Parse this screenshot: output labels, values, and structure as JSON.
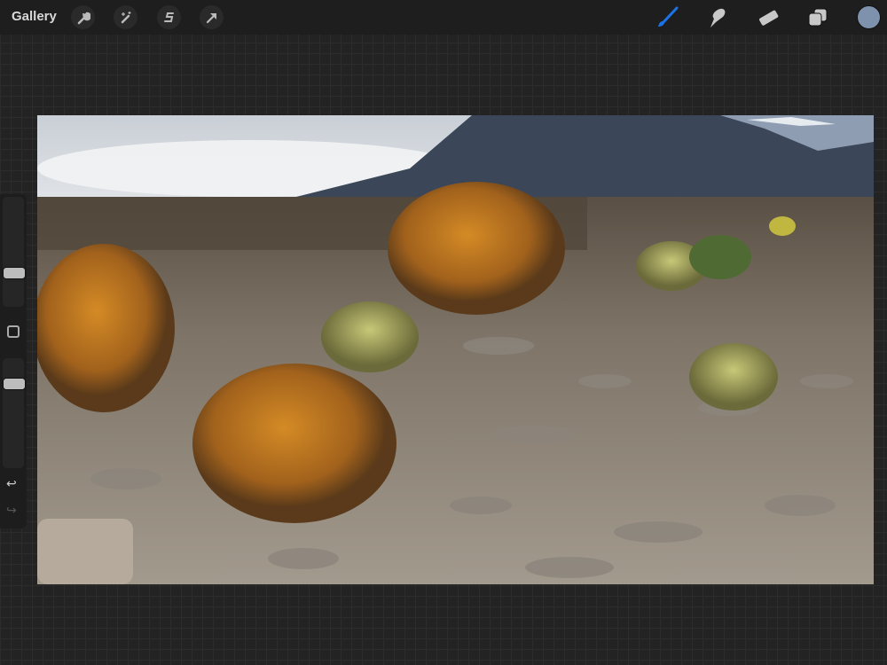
{
  "topbar": {
    "gallery_label": "Gallery",
    "left_tools": [
      "wrench-icon",
      "magic-wand-icon",
      "selection-icon",
      "transform-arrow-icon"
    ],
    "right_tools": [
      "brush-icon",
      "smudge-icon",
      "eraser-icon",
      "layers-icon"
    ],
    "active_tool": "brush",
    "accent_color": "#1a73e8",
    "current_color": "#7e92ae"
  },
  "sidebar": {
    "brush_size": 0.28,
    "opacity": 0.8,
    "undo_icon": "undo-icon",
    "redo_icon": "redo-icon"
  }
}
